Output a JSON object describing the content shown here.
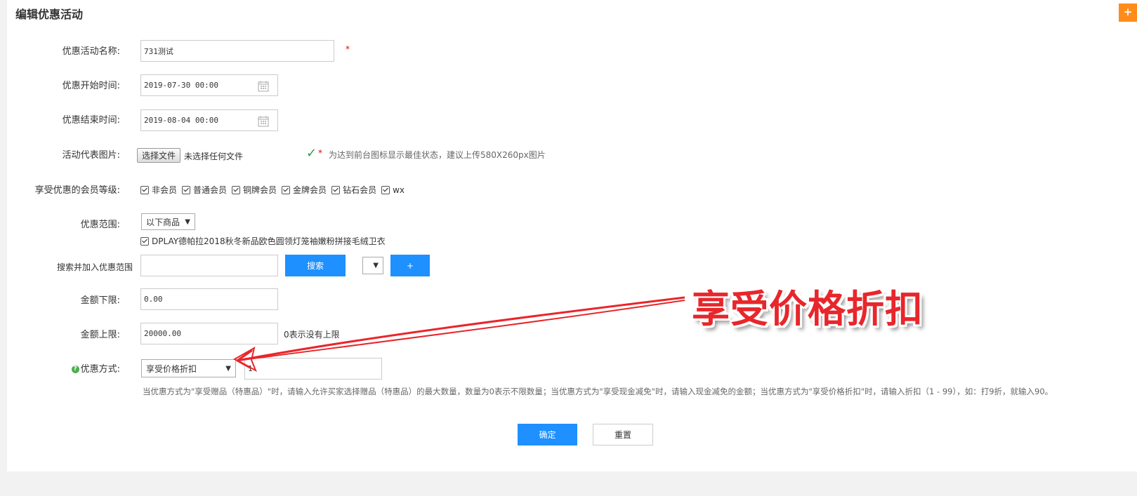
{
  "page": {
    "title": "编辑优惠活动",
    "corner_button": "+"
  },
  "form": {
    "name": {
      "label": "优惠活动名称:",
      "value": "731测试",
      "required": "*"
    },
    "start_time": {
      "label": "优惠开始时间:",
      "value": "2019-07-30 00:00"
    },
    "end_time": {
      "label": "优惠结束时间:",
      "value": "2019-08-04 00:00"
    },
    "image": {
      "label": "活动代表图片:",
      "button": "选择文件",
      "status": "未选择任何文件",
      "check": "✓",
      "required": "*",
      "hint": "为达到前台图标显示最佳状态，建议上传580X260px图片"
    },
    "member_levels": {
      "label": "享受优惠的会员等级:",
      "options": [
        "非会员",
        "普通会员",
        "铜牌会员",
        "金牌会员",
        "钻石会员",
        "wx"
      ]
    },
    "scope": {
      "label": "优惠范围:",
      "selected": "以下商品",
      "product": "DPLAY德帕拉2018秋冬新品欧色圆领灯笼袖嫩粉拼接毛绒卫衣"
    },
    "search": {
      "label": "搜索并加入优惠范围",
      "value": "",
      "search_button": "搜索",
      "add_button": "+"
    },
    "min_amount": {
      "label": "金额下限:",
      "value": "0.00"
    },
    "max_amount": {
      "label": "金额上限:",
      "value": "20000.00",
      "hint": "0表示没有上限"
    },
    "method": {
      "label": "优惠方式:",
      "help_icon": "?",
      "selected": "享受价格折扣",
      "value": "1",
      "note": "当优惠方式为\"享受赠品（特惠品）\"时，请输入允许买家选择赠品（特惠品）的最大数量，数量为0表示不限数量；当优惠方式为\"享受现金减免\"时，请输入现金减免的金额；当优惠方式为\"享受价格折扣\"时，请输入折扣（1 - 99），如：打9折，就输入90。"
    }
  },
  "actions": {
    "confirm": "确定",
    "reset": "重置"
  },
  "annotation": {
    "text": "享受价格折扣"
  },
  "colors": {
    "primary": "#1e90ff",
    "annotation": "#e8262b",
    "corner": "#ff8c1a"
  },
  "icons": {
    "calendar": "calendar-icon",
    "arrow": "dropdown-arrow-icon"
  }
}
